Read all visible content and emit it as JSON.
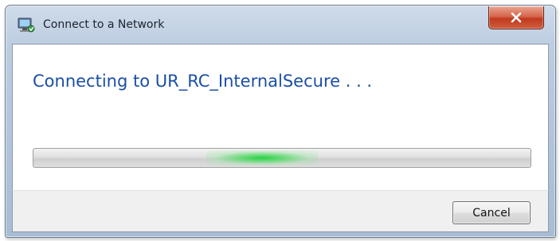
{
  "window": {
    "title": "Connect to a Network",
    "icon": "network-computer-icon",
    "close_icon": "close-icon"
  },
  "main": {
    "status_text": "Connecting to UR_RC_InternalSecure . . ."
  },
  "progress": {
    "mode": "indeterminate",
    "glow_position": 0.46,
    "glow_color": "#28d246"
  },
  "footer": {
    "cancel_label": "Cancel"
  },
  "colors": {
    "heading": "#1a4fa6",
    "close_button": "#c23a1f"
  }
}
